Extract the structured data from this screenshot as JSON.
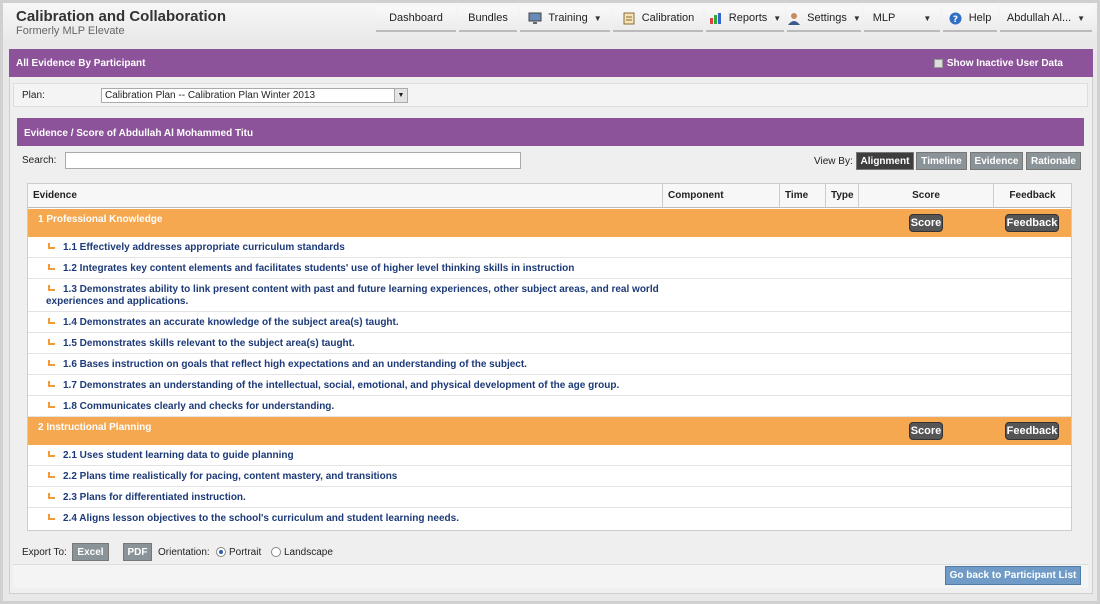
{
  "app": {
    "title": "Calibration and Collaboration",
    "subtitle": "Formerly MLP Elevate"
  },
  "nav": {
    "dashboard": "Dashboard",
    "bundles": "Bundles",
    "training": "Training",
    "calibration": "Calibration",
    "reports": "Reports",
    "settings": "Settings",
    "mlp": "MLP",
    "help": "Help",
    "user": "Abdullah Al..."
  },
  "panel": {
    "title": "All Evidence By Participant",
    "show_inactive": "Show Inactive User Data"
  },
  "plan": {
    "label": "Plan:",
    "selected": "Calibration Plan -- Calibration Plan Winter 2013"
  },
  "evidence_panel": {
    "title": "Evidence / Score of Abdullah Al Mohammed Titu",
    "search_label": "Search:",
    "search_value": "",
    "view_by_label": "View By:",
    "view_by": [
      "Alignment",
      "Timeline",
      "Evidence",
      "Rationale"
    ],
    "view_by_active": "Alignment"
  },
  "table": {
    "columns": [
      "Evidence",
      "Component",
      "Time",
      "Type",
      "Score",
      "Feedback"
    ],
    "score_label": "Score",
    "feedback_label": "Feedback",
    "standards": [
      {
        "title": "1 Professional Knowledge",
        "elements": [
          "1.1 Effectively addresses appropriate curriculum standards",
          "1.2 Integrates key content elements and facilitates students' use of higher level thinking skills in instruction",
          "1.3 Demonstrates ability to link present content with past and future learning experiences, other subject areas, and real world experiences and applications.",
          "1.4 Demonstrates an accurate knowledge of the subject area(s) taught.",
          "1.5 Demonstrates skills relevant to the subject area(s) taught.",
          "1.6 Bases instruction on goals that reflect high expectations and an understanding of the subject.",
          "1.7 Demonstrates an understanding of the intellectual, social, emotional, and physical development of the age group.",
          "1.8 Communicates clearly and checks for understanding."
        ]
      },
      {
        "title": "2 Instructional Planning",
        "elements": [
          "2.1 Uses student learning data to guide planning",
          "2.2 Plans time realistically for pacing, content mastery, and transitions",
          "2.3 Plans for differentiated instruction.",
          "2.4 Aligns lesson objectives to the school's curriculum and student learning needs."
        ]
      }
    ]
  },
  "footer": {
    "export_label": "Export To:",
    "excel": "Excel",
    "pdf": "PDF",
    "orientation_label": "Orientation:",
    "portrait": "Portrait",
    "landscape": "Landscape",
    "orientation_selected": "Portrait",
    "back_button": "Go back to Participant List"
  },
  "colors": {
    "purple": "#8c529a",
    "orange": "#f6a850",
    "link_blue": "#1c3a78",
    "back_button": "#6f9bc6"
  }
}
